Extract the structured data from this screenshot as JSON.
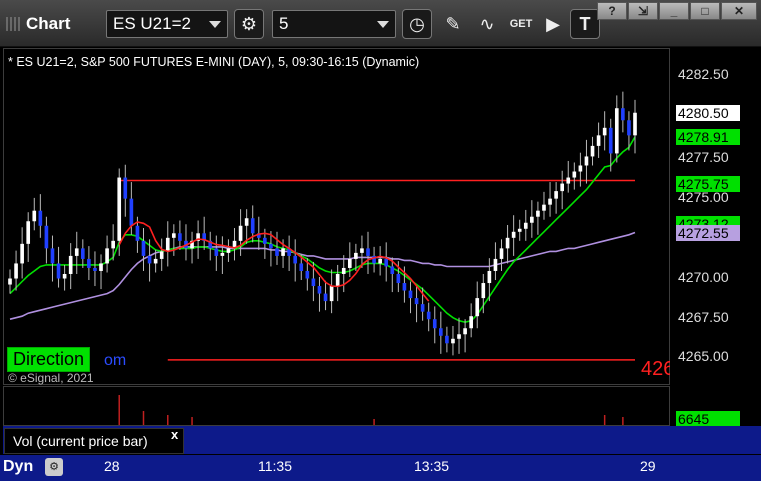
{
  "window": {
    "title": "Chart",
    "symbol": "ES U21=2",
    "interval": "5",
    "controls": [
      "?",
      "⇲",
      "_",
      "□",
      "✕"
    ]
  },
  "toolbar_icons": [
    "gear-icon",
    "clock-icon",
    "pencil-icon",
    "study-icon",
    "get-icon",
    "play-icon",
    "text-icon"
  ],
  "chart_header": "* ES U21=2, S&P 500 FUTURES E-MINI (DAY), 5, 09:30-16:15 (Dynamic)",
  "copyright": "© eSignal, 2021",
  "direction_label": "Direction",
  "direction_tail": "om",
  "edge_label": "426",
  "price_labels": [
    "4282.50",
    "4280.00",
    "4277.50",
    "4275.00",
    "4270.00",
    "4267.50",
    "4265.00"
  ],
  "price_tags": [
    {
      "text": "4280.50",
      "bg": "#ffffff",
      "fg": "#000000",
      "price": 4280.5
    },
    {
      "text": "4278.91",
      "bg": "#00e000",
      "fg": "#000000",
      "price": 4278.91
    },
    {
      "text": "4275.75",
      "bg": "#00e000",
      "fg": "#000000",
      "price": 4275.75
    },
    {
      "text": "4273.12",
      "bg": "#00e000",
      "fg": "#000000",
      "price": 4273.12
    },
    {
      "text": "4272.55",
      "bg": "#b7a0e0",
      "fg": "#000000",
      "price": 4272.55
    }
  ],
  "volume": {
    "label": "Vol (current price bar)",
    "close": "x",
    "last": "6645"
  },
  "time_axis": {
    "mode": "Dyn",
    "labels": [
      "28",
      "11:35",
      "13:35",
      "29"
    ]
  },
  "chart_data": {
    "type": "candlestick",
    "title": "* ES U21=2, S&P 500 FUTURES E-MINI (DAY), 5, 09:30-16:15 (Dynamic)",
    "ylim": [
      4262.5,
      4284.0
    ],
    "colors": {
      "up": "#ffffff",
      "down": "#2040ff",
      "ma_fast": "#00e000",
      "ma_slow": "#b090e0",
      "trail": "#ff2020",
      "levels": "#ff2020"
    },
    "closes": [
      4269.5,
      4270.5,
      4271.8,
      4273.3,
      4274.0,
      4273.0,
      4271.5,
      4270.5,
      4269.5,
      4269.8,
      4271.0,
      4271.5,
      4270.8,
      4270.2,
      4270.0,
      4270.5,
      4271.5,
      4272.0,
      4276.2,
      4274.8,
      4273.0,
      4272.0,
      4271.0,
      4270.5,
      4270.8,
      4271.3,
      4272.2,
      4272.5,
      4272.0,
      4271.5,
      4272.0,
      4272.5,
      4272.0,
      4271.5,
      4271.0,
      4271.2,
      4271.5,
      4272.0,
      4273.0,
      4273.5,
      4272.5,
      4272.2,
      4271.8,
      4271.5,
      4271.0,
      4271.5,
      4271.0,
      4270.5,
      4270.0,
      4269.5,
      4269.0,
      4268.5,
      4268.0,
      4269.0,
      4269.8,
      4270.2,
      4270.8,
      4271.2,
      4271.5,
      4271.0,
      4270.5,
      4270.8,
      4270.3,
      4269.8,
      4269.2,
      4268.7,
      4268.2,
      4267.8,
      4267.3,
      4266.8,
      4266.2,
      4265.7,
      4265.2,
      4265.5,
      4265.8,
      4266.2,
      4267.0,
      4268.2,
      4269.2,
      4270.0,
      4270.8,
      4271.5,
      4272.2,
      4272.6,
      4272.8,
      4273.2,
      4273.6,
      4274.0,
      4274.4,
      4274.8,
      4275.3,
      4275.8,
      4276.2,
      4276.6,
      4277.0,
      4277.6,
      4278.3,
      4279.0,
      4279.5,
      4277.8,
      4280.8,
      4280.0,
      4279.0,
      4280.5
    ],
    "ma_fast": [
      4268.5,
      4268.9,
      4269.3,
      4269.7,
      4270.0,
      4270.3,
      4270.4,
      4270.4,
      4270.4,
      4270.4,
      4270.4,
      4270.4,
      4270.4,
      4270.4,
      4270.4,
      4270.4,
      4270.6,
      4270.9,
      4271.9,
      4272.4,
      4272.4,
      4272.3,
      4272.0,
      4271.7,
      4271.4,
      4271.3,
      4271.4,
      4271.5,
      4271.5,
      4271.5,
      4271.5,
      4271.6,
      4271.6,
      4271.5,
      4271.4,
      4271.3,
      4271.3,
      4271.4,
      4271.6,
      4271.9,
      4272.0,
      4272.0,
      4271.9,
      4271.8,
      4271.6,
      4271.5,
      4271.4,
      4271.2,
      4271.0,
      4270.8,
      4270.5,
      4270.2,
      4270.0,
      4269.9,
      4269.9,
      4269.9,
      4270.0,
      4270.2,
      4270.4,
      4270.5,
      4270.5,
      4270.5,
      4270.4,
      4270.2,
      4270.0,
      4269.7,
      4269.4,
      4269.1,
      4268.8,
      4268.4,
      4268.0,
      4267.6,
      4267.2,
      4266.9,
      4266.7,
      4266.6,
      4266.7,
      4267.1,
      4267.7,
      4268.3,
      4268.9,
      4269.5,
      4270.1,
      4270.6,
      4271.0,
      4271.4,
      4271.8,
      4272.2,
      4272.6,
      4273.0,
      4273.4,
      4273.8,
      4274.2,
      4274.6,
      4275.0,
      4275.4,
      4275.9,
      4276.4,
      4276.9,
      4277.0,
      4277.5,
      4277.9,
      4278.2,
      4278.9
    ],
    "ma_slow": [
      4266.8,
      4266.9,
      4267.0,
      4267.2,
      4267.3,
      4267.4,
      4267.5,
      4267.6,
      4267.7,
      4267.8,
      4267.9,
      4268.0,
      4268.1,
      4268.2,
      4268.3,
      4268.4,
      4268.5,
      4268.7,
      4269.1,
      4269.6,
      4270.1,
      4270.5,
      4270.8,
      4271.0,
      4271.2,
      4271.3,
      4271.4,
      4271.5,
      4271.6,
      4271.6,
      4271.6,
      4271.6,
      4271.6,
      4271.6,
      4271.6,
      4271.6,
      4271.5,
      4271.5,
      4271.5,
      4271.5,
      4271.5,
      4271.5,
      4271.5,
      4271.4,
      4271.4,
      4271.3,
      4271.3,
      4271.2,
      4271.1,
      4271.0,
      4271.0,
      4270.9,
      4270.8,
      4270.8,
      4270.8,
      4270.8,
      4270.8,
      4270.9,
      4270.9,
      4270.9,
      4270.9,
      4270.9,
      4270.9,
      4270.8,
      4270.8,
      4270.7,
      4270.7,
      4270.6,
      4270.5,
      4270.5,
      4270.4,
      4270.4,
      4270.3,
      4270.3,
      4270.3,
      4270.3,
      4270.3,
      4270.3,
      4270.3,
      4270.3,
      4270.4,
      4270.5,
      4270.6,
      4270.7,
      4270.8,
      4270.9,
      4271.0,
      4271.1,
      4271.2,
      4271.3,
      4271.3,
      4271.4,
      4271.5,
      4271.5,
      4271.6,
      4271.7,
      4271.8,
      4271.9,
      4272.0,
      4272.1,
      4272.2,
      4272.3,
      4272.4,
      4272.55
    ],
    "levels": [
      {
        "price": 4276.0,
        "from": 18,
        "to": 103
      },
      {
        "price": 4264.1,
        "from": 26,
        "to": 103
      }
    ]
  }
}
